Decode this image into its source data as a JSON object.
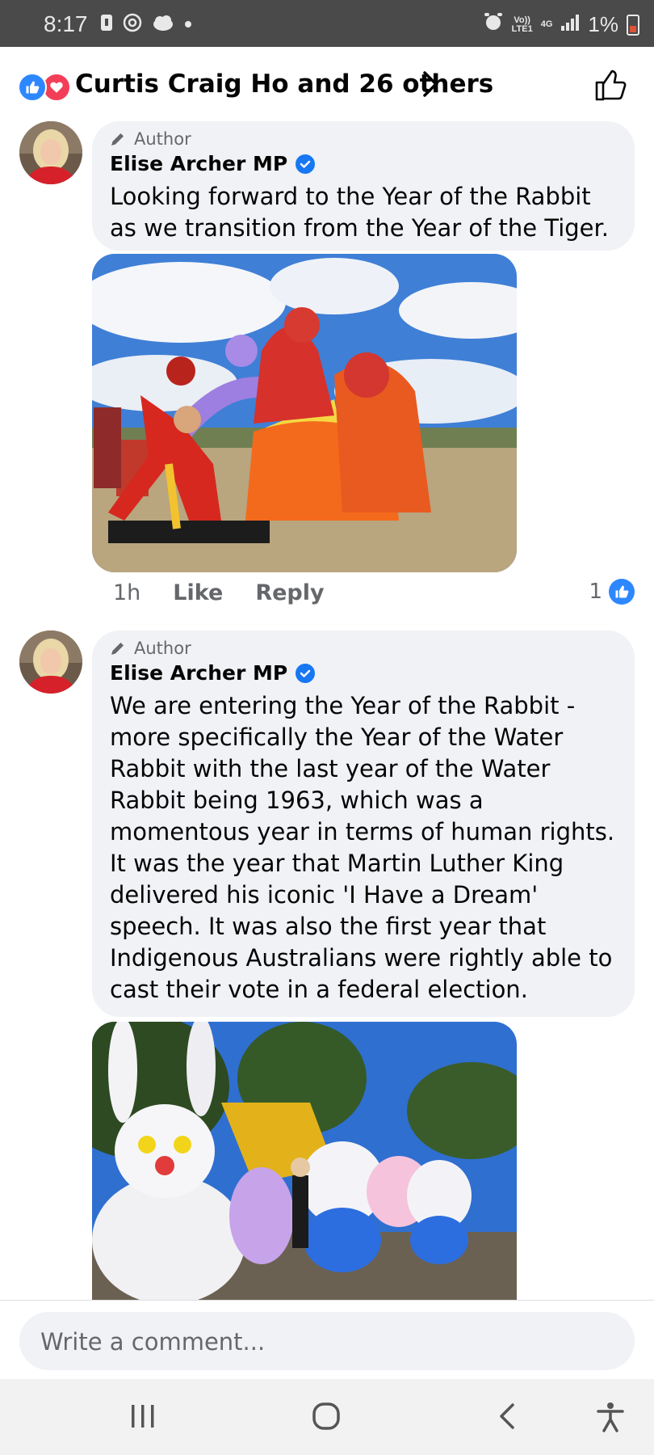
{
  "status_bar": {
    "time": "8:17",
    "network_top": "Vo))",
    "network_bottom": "LTE1",
    "network_gen": "4G",
    "battery": "1%"
  },
  "reactions": {
    "summary": "Curtis Craig Ho and 26 others",
    "icons": [
      "like-icon",
      "love-icon"
    ]
  },
  "comments": [
    {
      "badge": "Author",
      "author": "Elise Archer MP",
      "text": "Looking forward to the Year of the Rabbit as we transition from the Year of the Tiger.",
      "time": "1h",
      "like_label": "Like",
      "reply_label": "Reply",
      "like_count": "1"
    },
    {
      "badge": "Author",
      "author": "Elise Archer MP",
      "text": "We are entering the Year of the Rabbit - more specifically the Year of the Water Rabbit with the last year of the Water Rabbit being 1963, which was a momentous year in terms of human rights. It was the year that Martin Luther King delivered his iconic 'I Have a Dream' speech. It was also the first year that Indigenous Australians were rightly able to cast their vote in a federal election."
    }
  ],
  "composer": {
    "placeholder": "Write a comment..."
  },
  "colors": {
    "accent": "#1877f2",
    "like_blue": "#2d88ff",
    "love_red": "#f33e58",
    "bubble": "#f0f2f5"
  }
}
